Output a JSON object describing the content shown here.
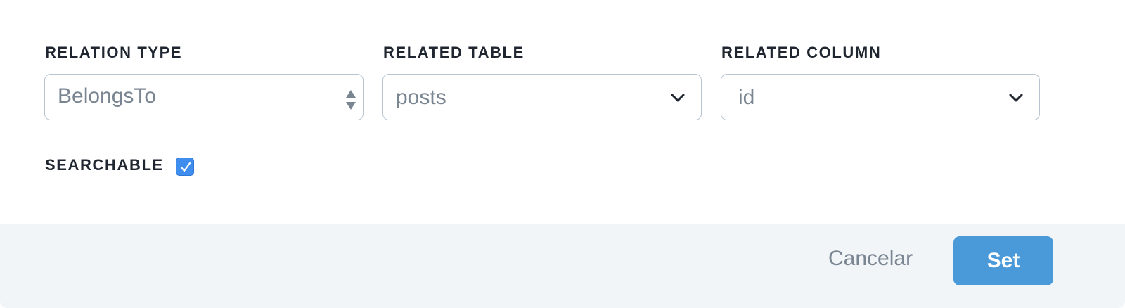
{
  "fields": [
    {
      "label": "RELATION TYPE",
      "value": "BelongsTo",
      "control": "stepper"
    },
    {
      "label": "RELATED TABLE",
      "value": "posts",
      "control": "dropdown"
    },
    {
      "label": "RELATED COLUMN",
      "value": "id",
      "control": "dropdown"
    }
  ],
  "searchable": {
    "label": "SEARCHABLE",
    "checked": true
  },
  "footer": {
    "cancel_label": "Cancelar",
    "set_label": "Set"
  },
  "colors": {
    "label_text": "#1f2630",
    "value_text": "#7a8592",
    "border": "#b9c6d2",
    "checkbox": "#3f8def",
    "footer_bg": "#f1f5f8",
    "primary_button": "#4a9ad9"
  },
  "icons": {
    "relation_type_control": "updown-stepper-icon",
    "related_table_control": "chevron-down-icon",
    "related_column_control": "chevron-down-icon",
    "checkbox_mark": "checkmark-icon"
  }
}
